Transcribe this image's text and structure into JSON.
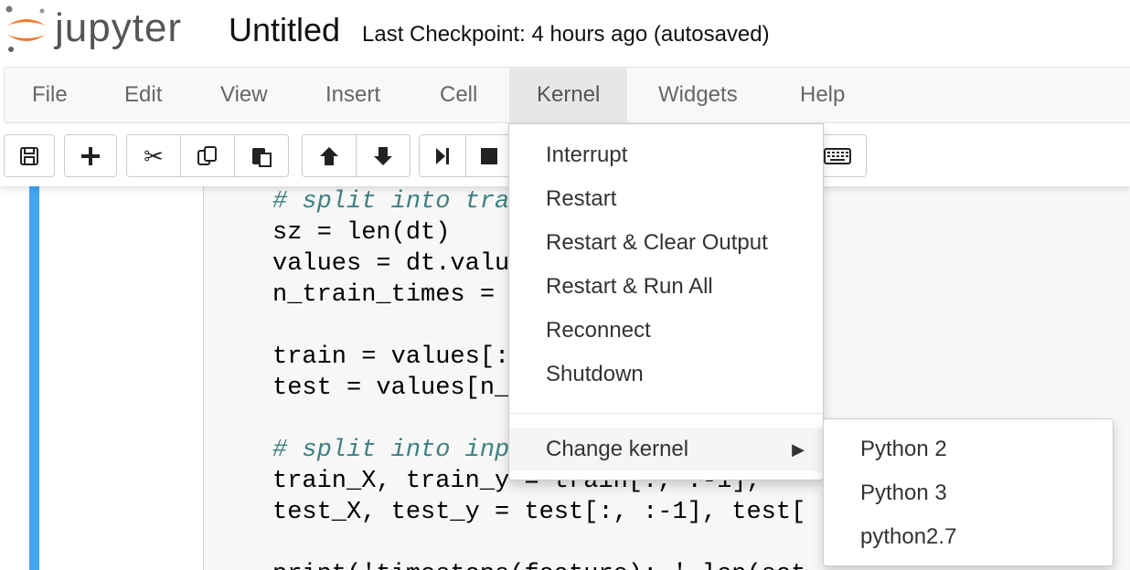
{
  "header": {
    "logo_text": "jupyter",
    "notebook_title": "Untitled",
    "checkpoint": "Last Checkpoint: 4 hours ago (autosaved)"
  },
  "menubar": {
    "items": [
      "File",
      "Edit",
      "View",
      "Insert",
      "Cell",
      "Kernel",
      "Widgets",
      "Help"
    ],
    "active": "Kernel"
  },
  "toolbar": {
    "icons": [
      "save-icon",
      "plus-icon",
      "cut-icon",
      "copy-icon",
      "paste-icon",
      "arrow-up-icon",
      "arrow-down-icon",
      "run-icon",
      "stop-icon",
      "keyboard-icon"
    ]
  },
  "code": {
    "lines": [
      "# split into tra",
      "sz = len(dt)",
      "values = dt.valu",
      "n_train_times = ",
      "",
      "train = values[:",
      "test = values[n_",
      "",
      "# split into inp",
      "train_X, train_y = train[:, :-1], ",
      "test_X, test_y = test[:, :-1], test[",
      "",
      "print('timesteps(feature): ',len(set"
    ]
  },
  "kernel_menu": {
    "items": [
      "Interrupt",
      "Restart",
      "Restart & Clear Output",
      "Restart & Run All",
      "Reconnect",
      "Shutdown"
    ],
    "change_kernel": "Change kernel"
  },
  "kernel_submenu": {
    "items": [
      "Python 2",
      "Python 3",
      "python2.7"
    ]
  },
  "colors": {
    "accent_cell_bar": "#42a5f5",
    "logo_orange": "#f37726"
  }
}
